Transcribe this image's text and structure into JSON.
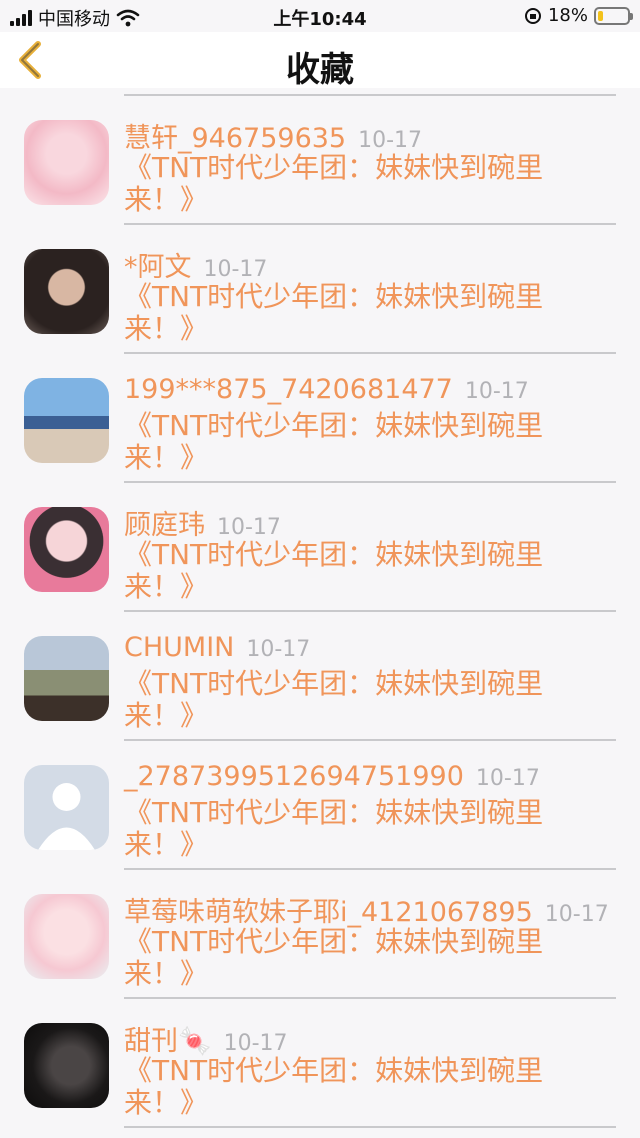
{
  "status_bar": {
    "carrier": "中国移动",
    "time": "上午10:44",
    "battery_percent": "18%",
    "battery_level": 0.18,
    "colors": {
      "battery": "#f3c21b"
    }
  },
  "nav": {
    "back_icon": "chevron-left-icon",
    "title": "收藏"
  },
  "colors": {
    "accent_text": "#f0955a",
    "date_text": "#b2b2b6",
    "divider": "#c9c9cc"
  },
  "items": [
    {
      "name": "慧轩_946759635",
      "date": "10-17",
      "content": "《TNT时代少年团：妹妹快到碗里来！》"
    },
    {
      "name": "*阿文",
      "date": "10-17",
      "content": "《TNT时代少年团：妹妹快到碗里来！》"
    },
    {
      "name": "199***875_7420681477",
      "date": "10-17",
      "content": "《TNT时代少年团：妹妹快到碗里来！》"
    },
    {
      "name": "顾庭玮",
      "date": "10-17",
      "content": "《TNT时代少年团：妹妹快到碗里来！》"
    },
    {
      "name": "CHUMIN",
      "date": "10-17",
      "content": "《TNT时代少年团：妹妹快到碗里来！》"
    },
    {
      "name": "_2787399512694751990",
      "date": "10-17",
      "content": "《TNT时代少年团：妹妹快到碗里来！》"
    },
    {
      "name": "草莓味萌软妹子耶i_4121067895",
      "date": "10-17",
      "content": "《TNT时代少年团：妹妹快到碗里来！》"
    },
    {
      "name": "甜刊🍬",
      "date": "10-17",
      "content": "《TNT时代少年团：妹妹快到碗里来！》"
    }
  ]
}
